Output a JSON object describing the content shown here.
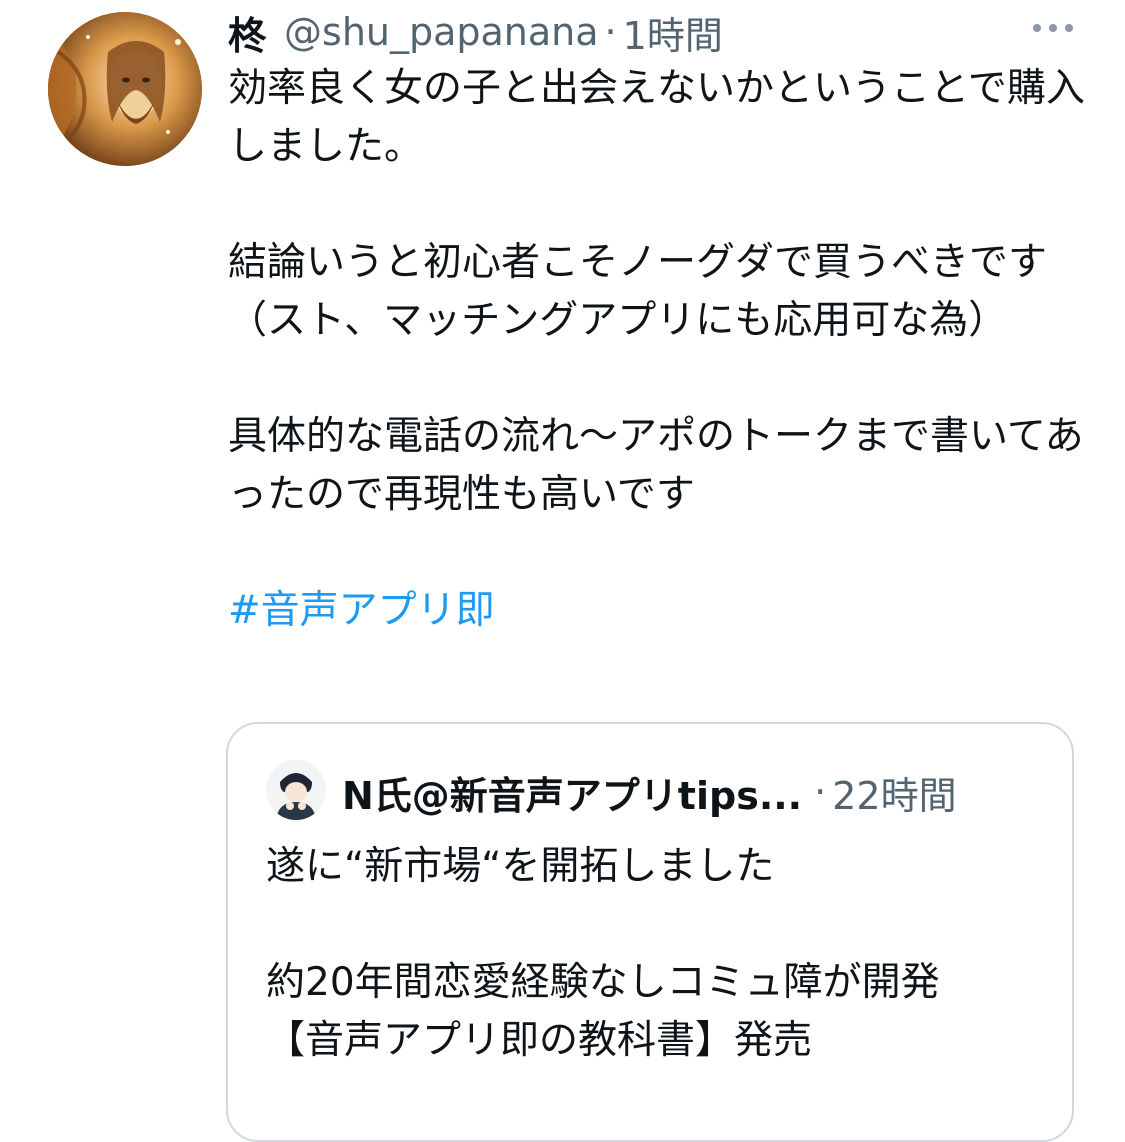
{
  "tweet": {
    "display_name": "柊",
    "handle": "@shu_papanana",
    "separator": "·",
    "time": "1時間",
    "more_icon": "more-horizontal-icon",
    "avatar": "user-avatar",
    "paragraphs": [
      "効率良く女の子と出会えないかということで購入しました。",
      "結論いうと初心者こそノーグダで買うべきです（スト、マッチングアプリにも応用可な為）",
      "具体的な電話の流れ〜アポのトークまで書いてあったので再現性も高いです"
    ],
    "hashtag": "#音声アプリ即"
  },
  "quoted": {
    "display_name": "N氏@新音声アプリtips...",
    "separator": "·",
    "time": "22時間",
    "avatar": "quoted-user-avatar",
    "lines": [
      "遂に“新市場“を開拓しました",
      "約20年間恋愛経験なしコミュ障が開発",
      "【音声アプリ即の教科書】発売"
    ]
  },
  "colors": {
    "text": "#0f1419",
    "secondary": "#536471",
    "link": "#1d9bf0",
    "border": "#cfd9de"
  }
}
